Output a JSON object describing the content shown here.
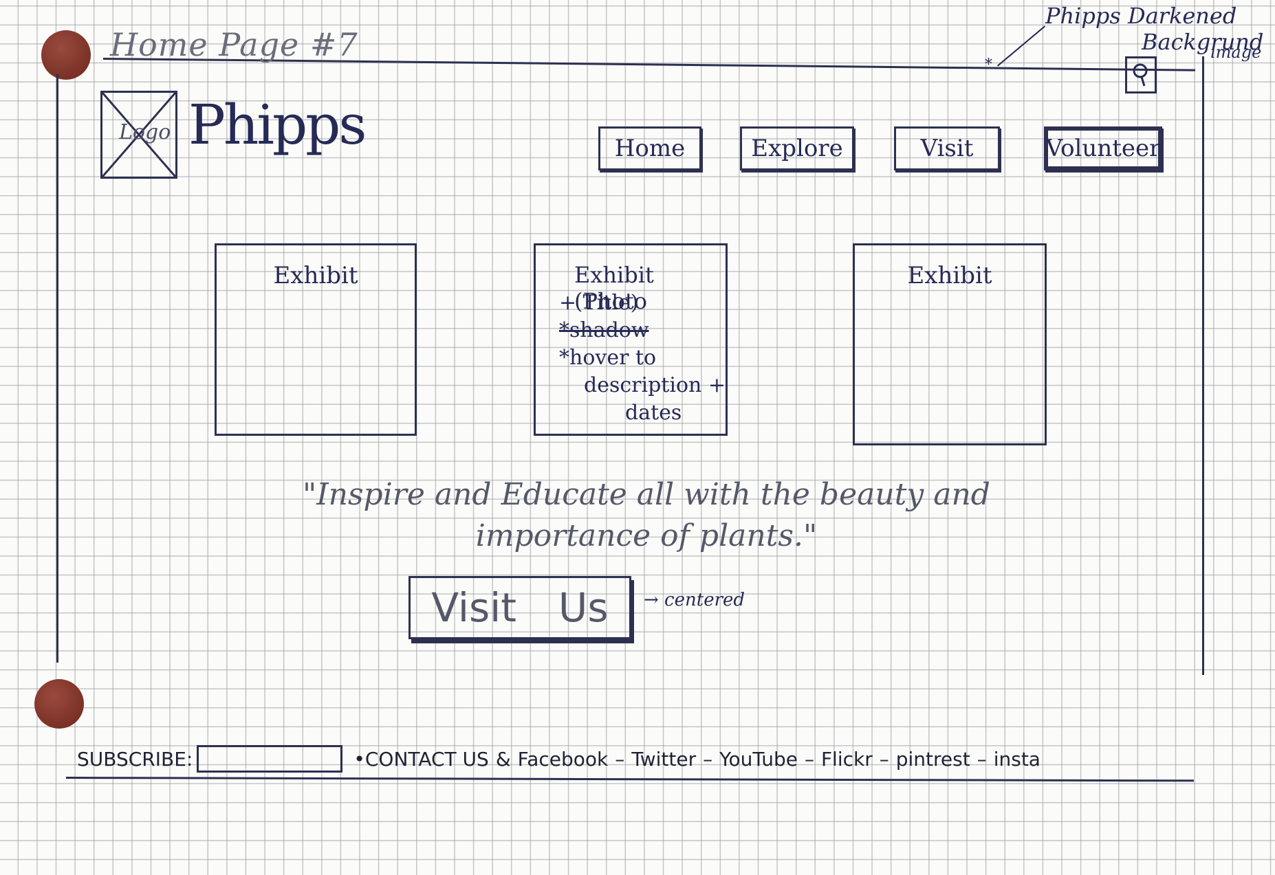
{
  "page_title": "Home Page #7",
  "notes": {
    "background_line1": "Phipps Darkened",
    "background_line2": "Backgrund",
    "background_line3": "image",
    "cta_note": "→ centered"
  },
  "header": {
    "logo_text": "Logo",
    "brand": "Phipps",
    "nav": [
      "Home",
      "Explore",
      "Visit",
      "Volunteer"
    ]
  },
  "exhibits": [
    {
      "title": "Exhibit"
    },
    {
      "title": "Exhibit (Photo",
      "notes": [
        "+ Title)",
        "*shadow",
        "*hover to",
        "description +",
        "dates"
      ]
    },
    {
      "title": "Exhibit"
    }
  ],
  "quote": "\"Inspire and Educate all with the beauty and importance of plants.\"",
  "cta": {
    "word1": "Visit",
    "word2": "Us"
  },
  "footer": {
    "subscribe_label": "SUBSCRIBE:",
    "contact": "•CONTACT US",
    "amp": "&",
    "social": [
      "Facebook",
      "Twitter",
      "YouTube",
      "Flickr",
      "pintrest",
      "insta"
    ],
    "separator": "–"
  },
  "colors": {
    "ink": "#262a55",
    "pencil": "#6a6d7a",
    "hole": "#7d3328",
    "grid": "#96989e"
  }
}
